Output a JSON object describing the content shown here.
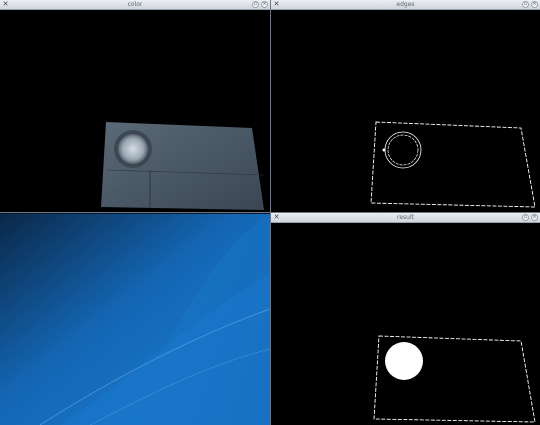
{
  "windows": {
    "color": {
      "title": "color",
      "min_glyph": "▫",
      "close_glyph": "×"
    },
    "edges": {
      "title": "edges",
      "min_glyph": "▫",
      "close_glyph": "×"
    },
    "third": {
      "title": "",
      "min_glyph": "▫",
      "close_glyph": "×"
    },
    "fourth": {
      "title": "result",
      "min_glyph": "▫",
      "close_glyph": "×"
    }
  },
  "icons": {
    "app_icon": "app-icon",
    "minimize": "minimize-icon",
    "close": "close-icon"
  },
  "colors": {
    "desktop_blue": "#1a73c4",
    "titlebar": "#dde2e8",
    "edge_white": "#ffffff"
  }
}
